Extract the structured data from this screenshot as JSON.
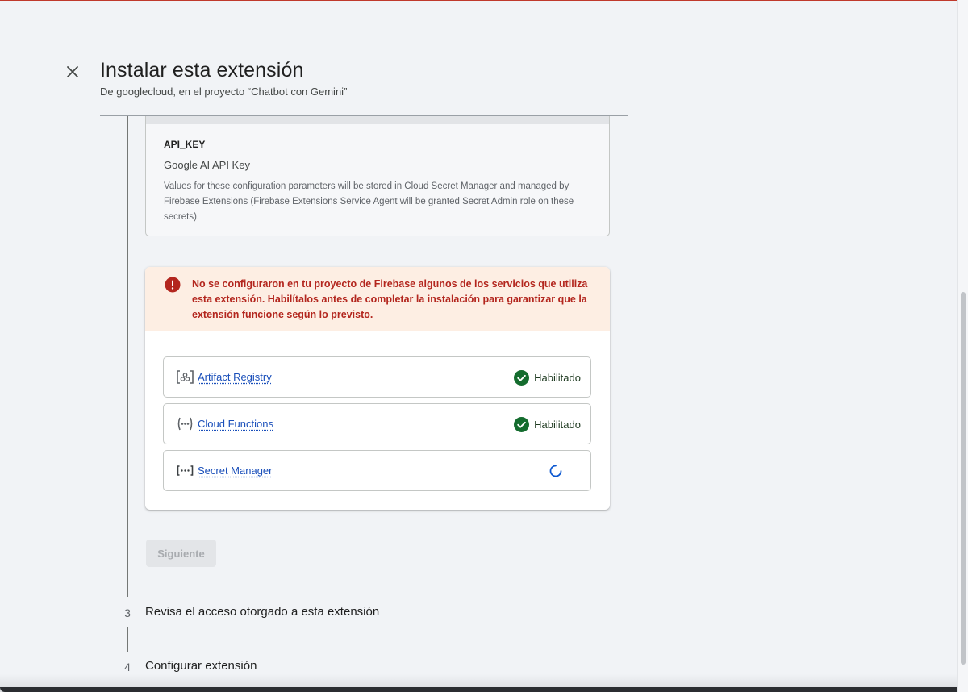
{
  "header": {
    "title": "Instalar esta extensión",
    "subtitle": "De googlecloud, en el proyecto “Chatbot con Gemini”",
    "close_icon": "close-icon"
  },
  "secret_param": {
    "key": "API_KEY",
    "label": "Google AI API Key",
    "description": "Values for these configuration parameters will be stored in Cloud Secret Manager and managed by Firebase Extensions (Firebase Extensions Service Agent will be granted Secret Admin role on these secrets)."
  },
  "warning": {
    "icon": "error-icon",
    "color": "#b3261e",
    "background": "#fdeee3",
    "text": "No se configuraron en tu proyecto de Firebase algunos de los servicios que utiliza esta extensión. Habilítalos antes de completar la instalación para garantizar que la extensión funcione según lo previsto."
  },
  "services": [
    {
      "name": "Artifact Registry",
      "icon": "artifact-registry-icon",
      "status": "Habilitado",
      "state": "enabled"
    },
    {
      "name": "Cloud Functions",
      "icon": "cloud-functions-icon",
      "status": "Habilitado",
      "state": "enabled"
    },
    {
      "name": "Secret Manager",
      "icon": "secret-manager-icon",
      "status": "",
      "state": "loading"
    }
  ],
  "actions": {
    "next_label": "Siguiente",
    "next_disabled": true
  },
  "steps": [
    {
      "number": "3",
      "title": "Revisa el acceso otorgado a esta extensión"
    },
    {
      "number": "4",
      "title": "Configurar extensión"
    }
  ],
  "colors": {
    "enabled_check": "#146c2e",
    "link": "#1a4fba",
    "spinner": "#0b57d0"
  }
}
